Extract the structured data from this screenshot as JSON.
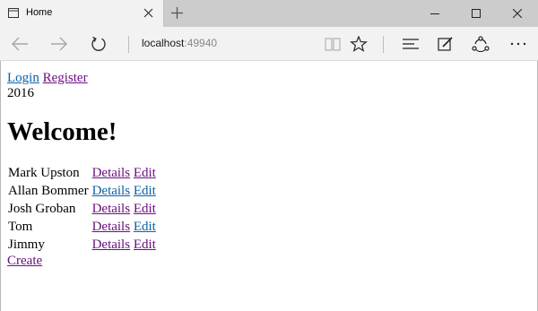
{
  "browser": {
    "tab_title": "Home",
    "address_host": "localhost",
    "address_port": ":49940"
  },
  "nav": {
    "login": "Login",
    "register": "Register",
    "year": "2016"
  },
  "heading": "Welcome!",
  "people": [
    {
      "name": "Mark Upston",
      "details": "Details",
      "edit": "Edit"
    },
    {
      "name": "Allan Bommer",
      "details": "Details",
      "edit": "Edit"
    },
    {
      "name": "Josh Groban",
      "details": "Details",
      "edit": "Edit"
    },
    {
      "name": "Tom",
      "details": "Details",
      "edit": "Edit"
    },
    {
      "name": "Jimmy",
      "details": "Details",
      "edit": "Edit"
    }
  ],
  "create": "Create",
  "colors": {
    "link_unvisited": "#0b61a4",
    "link_visited": "#6b0f80"
  }
}
